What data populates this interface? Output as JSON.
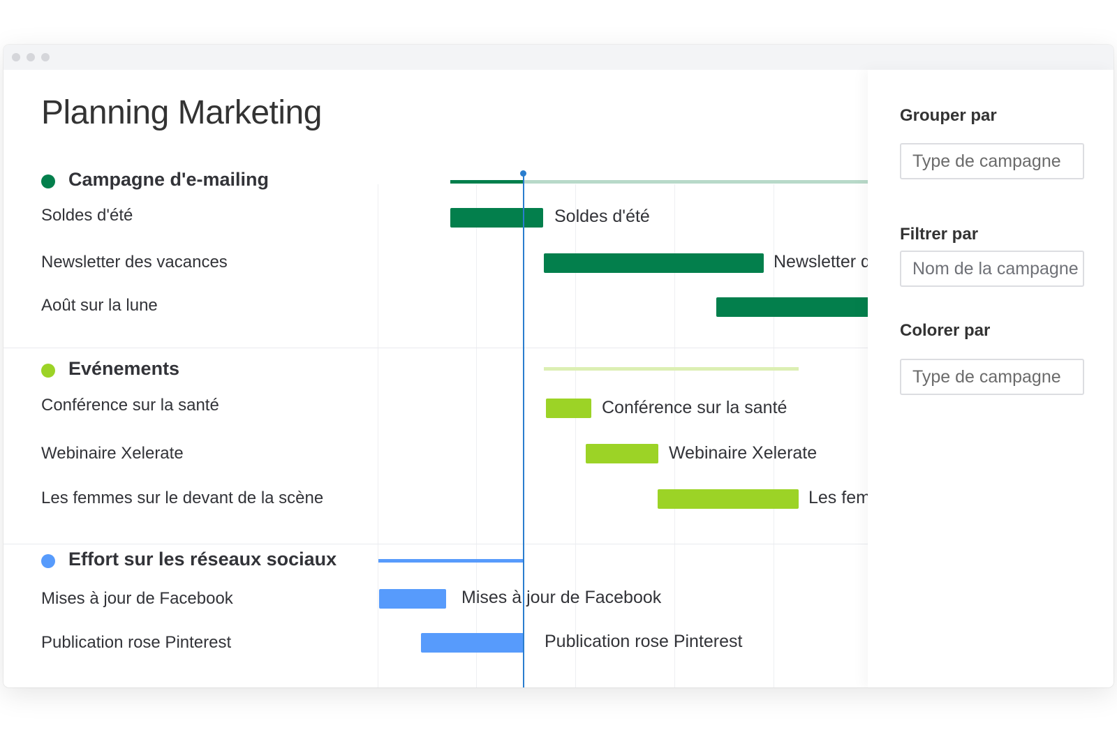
{
  "board": {
    "title": "Planning Marketing"
  },
  "colors": {
    "email": "#037f4c",
    "email_light": "#b8d9c9",
    "events": "#9cd326",
    "events_light": "#dcefb3",
    "social": "#579bfc",
    "today": "#2a7dce"
  },
  "groups": [
    {
      "name": "Campagne d'e-mailing",
      "items": [
        {
          "name": "Soldes d'été",
          "bar_label": "Soldes d'été"
        },
        {
          "name": "Newsletter des vacances",
          "bar_label": "Newsletter des vacances"
        },
        {
          "name": "Août sur la lune",
          "bar_label": ""
        }
      ]
    },
    {
      "name": "Evénements",
      "items": [
        {
          "name": "Conférence sur la santé",
          "bar_label": "Conférence sur la santé"
        },
        {
          "name": "Webinaire Xelerate",
          "bar_label": "Webinaire Xelerate"
        },
        {
          "name": "Les femmes sur le devant de la scène",
          "bar_label": "Les femmes sur le devant de la scène"
        }
      ]
    },
    {
      "name": "Effort sur les réseaux sociaux",
      "items": [
        {
          "name": "Mises à jour de Facebook",
          "bar_label": "Mises à jour de Facebook"
        },
        {
          "name": "Publication rose Pinterest",
          "bar_label": "Publication rose Pinterest"
        }
      ]
    }
  ],
  "side_panel": {
    "group_by": {
      "heading": "Grouper par",
      "value": "Type de campagne"
    },
    "filter_by": {
      "heading": "Filtrer par",
      "placeholder": "Nom de la campagne"
    },
    "color_by": {
      "heading": "Colorer par",
      "value": "Type de campagne"
    }
  }
}
